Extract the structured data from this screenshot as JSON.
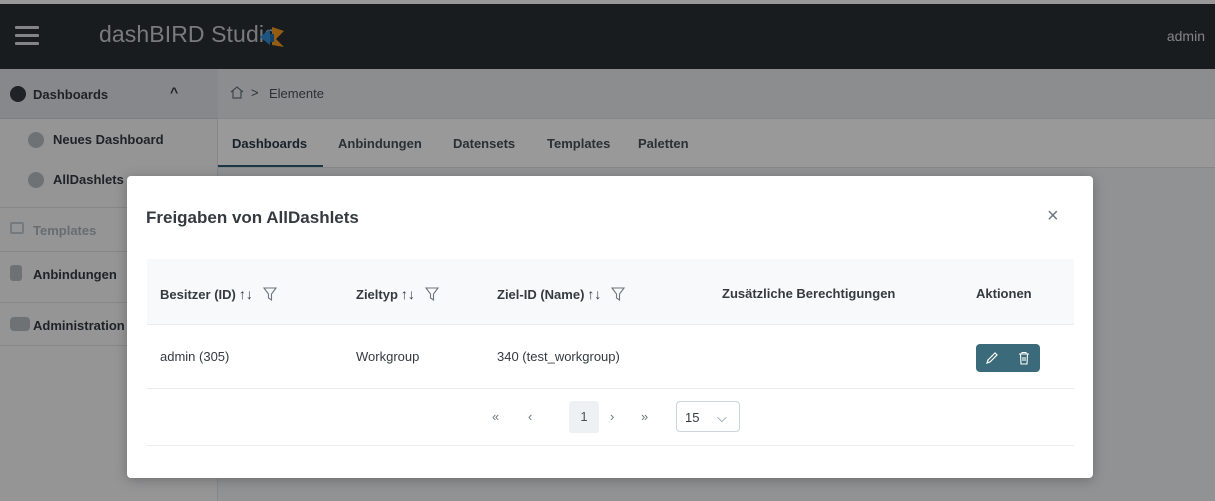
{
  "app": {
    "brand": "dashBIRD Studio",
    "user": "admin"
  },
  "sidebar": {
    "items": [
      {
        "label": "Dashboards",
        "caret": "^"
      },
      {
        "label": "Neues Dashboard"
      },
      {
        "label": "AllDashlets"
      },
      {
        "label": "Templates"
      },
      {
        "label": "Anbindungen"
      },
      {
        "label": "Administration"
      }
    ]
  },
  "breadcrumb": {
    "separator": ">",
    "current": "Elemente"
  },
  "tabs": [
    {
      "label": "Dashboards",
      "active": true
    },
    {
      "label": "Anbindungen"
    },
    {
      "label": "Datensets"
    },
    {
      "label": "Templates"
    },
    {
      "label": "Paletten"
    }
  ],
  "dialog": {
    "title": "Freigaben von AllDashlets",
    "close": "×",
    "columns": [
      {
        "label": "Besitzer (ID)",
        "sortable": true,
        "filterable": true
      },
      {
        "label": "Zieltyp",
        "sortable": true,
        "filterable": true
      },
      {
        "label": "Ziel-ID (Name)",
        "sortable": true,
        "filterable": true
      },
      {
        "label": "Zusätzliche Berechtigungen"
      },
      {
        "label": "Aktionen"
      }
    ],
    "rows": [
      {
        "owner": "admin (305)",
        "target_type": "Workgroup",
        "target_id": "340 (test_workgroup)",
        "extra": ""
      }
    ],
    "pagination": {
      "first": "«",
      "prev": "‹",
      "page": "1",
      "next": "›",
      "last": "»",
      "page_size": "15"
    }
  },
  "colors": {
    "header_bg": "#2b3034",
    "accent": "#3b6b7a",
    "logo_blue": "#2f8fd6",
    "logo_orange": "#f39c1f"
  }
}
